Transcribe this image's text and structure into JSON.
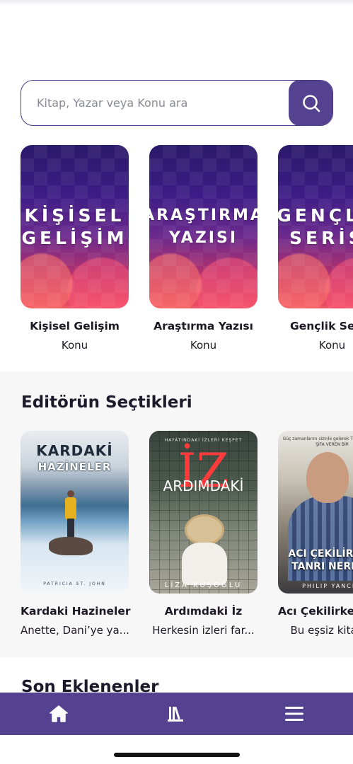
{
  "search": {
    "placeholder": "Kitap, Yazar veya Konu ara",
    "button_icon": "search-icon"
  },
  "topics": [
    {
      "cover_text": "KİŞİSEL\nGELİŞİM",
      "title": "Kişisel Gelişim",
      "subtitle": "Konu"
    },
    {
      "cover_text": "ARAŞTIRMA\nYAZISI",
      "title": "Araştırma Yazısı",
      "subtitle": "Konu"
    },
    {
      "cover_text": "GENÇLİK\nSERİSİ",
      "title": "Gençlik Serisi",
      "subtitle": "Konu"
    }
  ],
  "editor_picks": {
    "title": "Editörün Seçtikleri",
    "books": [
      {
        "cover_title": "KARDAKİ",
        "cover_subtitle": "HAZİNELER",
        "cover_author": "PATRICIA ST. JOHN",
        "title": "Kardaki Hazineler",
        "description": "Anette, Dani’ye ya..."
      },
      {
        "cover_tagline": "HAYATINDAKİ İZLERİ KEŞFET",
        "cover_big_letter": "İZ",
        "cover_title": "ARDIMDAKİ",
        "cover_author": "LİZA KUŞOĞLU",
        "title": "Ardımdaki İz",
        "description": "Herkesin izleri far..."
      },
      {
        "cover_tagline": "Güç zamanlarını sizinle gelerek TESELLİ EDEN, ŞİFA VEREN BİR",
        "cover_title": "ACI ÇEKİLİRKEN\nTANRI NEREDE",
        "cover_author": "PHILIP YANCEY",
        "title": "Acı Çekilirken Tanrı Nerede",
        "description": "Bu eşsiz kitap..."
      }
    ]
  },
  "recent": {
    "title": "Son Eklenenler"
  },
  "bottom_nav": [
    {
      "icon": "home-icon"
    },
    {
      "icon": "library-icon"
    },
    {
      "icon": "menu-icon"
    }
  ],
  "colors": {
    "accent": "#54418f",
    "section_bg": "#f7f7f7"
  }
}
